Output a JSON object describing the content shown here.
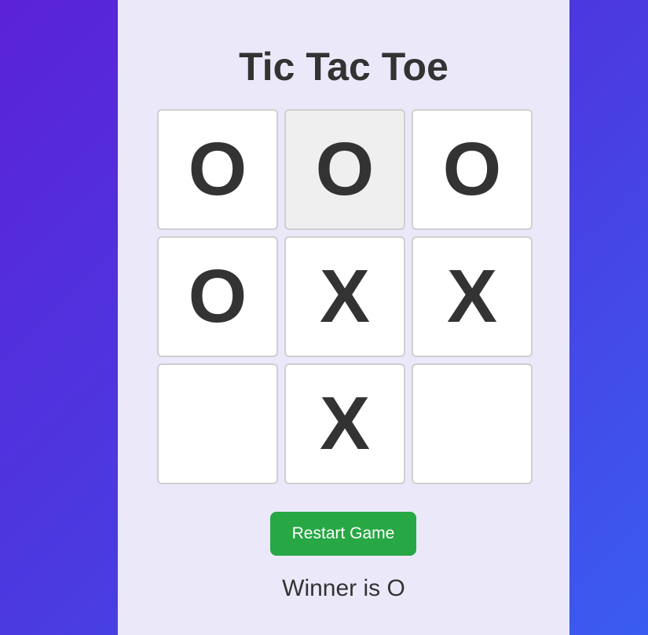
{
  "game": {
    "title": "Tic Tac Toe",
    "board": [
      "O",
      "O",
      "O",
      "O",
      "X",
      "X",
      "",
      "X",
      ""
    ],
    "hovered_cell": 1,
    "restart_label": "Restart Game",
    "status": "Winner is O"
  },
  "colors": {
    "background_start": "#5b22d8",
    "background_end": "#3a5cf0",
    "card": "#ebe9f9",
    "text": "#333333",
    "button": "#28a745"
  }
}
